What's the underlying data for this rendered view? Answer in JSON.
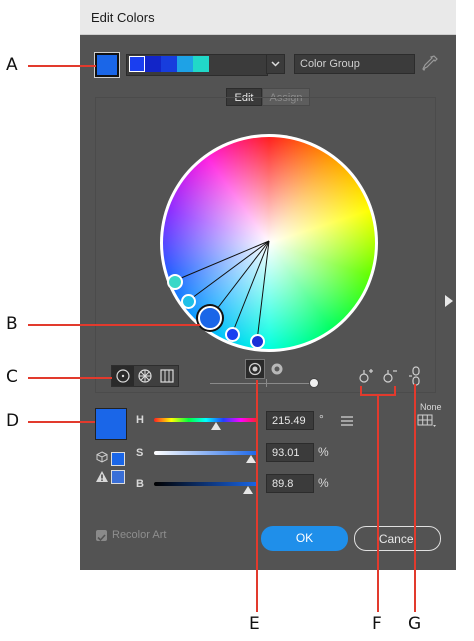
{
  "window": {
    "title": "Edit Colors"
  },
  "toolbar": {
    "group_name_placeholder": "Color Group",
    "swatches": [
      "#1a3ef0",
      "#1225c8",
      "#173ddd",
      "#1ea2e6",
      "#21d8c8"
    ]
  },
  "tabs": [
    {
      "label": "Edit",
      "active": true
    },
    {
      "label": "Assign",
      "active": false
    }
  ],
  "sliders": {
    "h": {
      "label": "H",
      "value": "215.49",
      "unit": "°",
      "position": 0.6
    },
    "s": {
      "label": "S",
      "value": "93.01",
      "unit": "%",
      "position": 0.93
    },
    "b": {
      "label": "B",
      "value": "89.8",
      "unit": "%",
      "position": 0.9
    }
  },
  "harmony": {
    "none_label": "None"
  },
  "footer": {
    "recolor_label": "Recolor Art",
    "ok_label": "OK",
    "cancel_label": "Cancel"
  },
  "callouts": {
    "a": "A",
    "b": "B",
    "c": "C",
    "d": "D",
    "e": "E",
    "f": "F",
    "g": "G"
  },
  "colors": {
    "base": "#1a66e8",
    "accent_red": "#e23a2d",
    "ok_button": "#1f8fea"
  }
}
